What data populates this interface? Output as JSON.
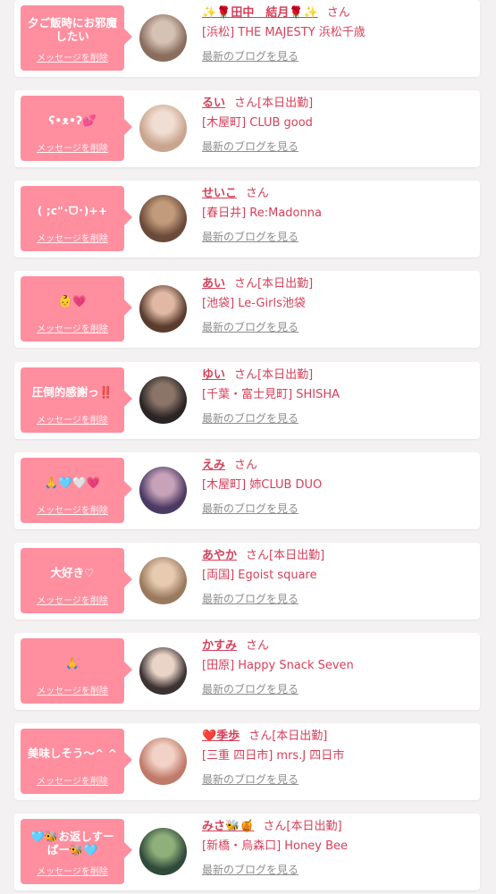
{
  "cards": [
    {
      "message": "夕ご飯時にお邪魔\nしたい",
      "delete_label": "メッセージを削除",
      "name": "✨🌹田中　結月🌹✨",
      "honorific": "さん",
      "status": "",
      "shop": "[浜松] THE MAJESTY 浜松千歳",
      "blog_link": "最新のブログを見る",
      "avatar_colors": [
        "#8a6d5c",
        "#d6c2b5"
      ]
    },
    {
      "message": "ʕ•ᴥ•ʔ💕",
      "delete_label": "メッセージを削除",
      "name": "るい",
      "honorific": "さん",
      "status": "[本日出勤]",
      "shop": "[木屋町] CLUB good",
      "blog_link": "最新のブログを見る",
      "avatar_colors": [
        "#c9a48e",
        "#f1ded2"
      ]
    },
    {
      "message": "( ;c\"･ᗜ･)++",
      "delete_label": "メッセージを削除",
      "name": "せいこ",
      "honorific": "さん",
      "status": "",
      "shop": "[春日井] Re:Madonna",
      "blog_link": "最新のブログを見る",
      "avatar_colors": [
        "#6b4a3a",
        "#c29b7c"
      ]
    },
    {
      "message": "👶💗",
      "delete_label": "メッセージを削除",
      "name": "あい",
      "honorific": "さん",
      "status": "[本日出勤]",
      "shop": "[池袋] Le-Girls池袋",
      "blog_link": "最新のブログを見る",
      "avatar_colors": [
        "#5a3c2e",
        "#e0b8a3"
      ]
    },
    {
      "message": "圧倒的感謝っ‼️",
      "delete_label": "メッセージを削除",
      "name": "ゆい",
      "honorific": "さん",
      "status": "[本日出勤]",
      "shop": "[千葉・富士見町] SHISHA",
      "blog_link": "最新のブログを見る",
      "avatar_colors": [
        "#2a2424",
        "#8b7568"
      ]
    },
    {
      "message": "🙏🩵🤍💗",
      "delete_label": "メッセージを削除",
      "name": "えみ",
      "honorific": "さん",
      "status": "",
      "shop": "[木屋町] 姉CLUB DUO",
      "blog_link": "最新のブログを見る",
      "avatar_colors": [
        "#4b3a63",
        "#c7a2b8"
      ]
    },
    {
      "message": "大好き♡",
      "delete_label": "メッセージを削除",
      "name": "あやか",
      "honorific": "さん",
      "status": "[本日出勤]",
      "shop": "[両国] Egoist square",
      "blog_link": "最新のブログを見る",
      "avatar_colors": [
        "#9a7a5e",
        "#e6cbb0"
      ]
    },
    {
      "message": "🙏",
      "delete_label": "メッセージを削除",
      "name": "かすみ",
      "honorific": "さん",
      "status": "",
      "shop": "[田原] Happy Snack Seven",
      "blog_link": "最新のブログを見る",
      "avatar_colors": [
        "#3c3232",
        "#e9d4c7"
      ]
    },
    {
      "message": "美味しそう〜^ ^",
      "delete_label": "メッセージを削除",
      "name": "❤️季歩",
      "honorific": "さん",
      "status": "[本日出勤]",
      "shop": "[三重 四日市] mrs.J 四日市",
      "blog_link": "最新のブログを見る",
      "avatar_colors": [
        "#c07a6a",
        "#f2d2c6"
      ]
    },
    {
      "message": "🩵🐝お返しすー\nぱー🐝🩵",
      "delete_label": "メッセージを削除",
      "name": "みさ🐝🍯",
      "honorific": "さん",
      "status": "[本日出勤]",
      "shop": "[新橋・烏森口] Honey Bee",
      "blog_link": "最新のブログを見る",
      "avatar_colors": [
        "#2f4a3a",
        "#8fb07a"
      ]
    }
  ]
}
